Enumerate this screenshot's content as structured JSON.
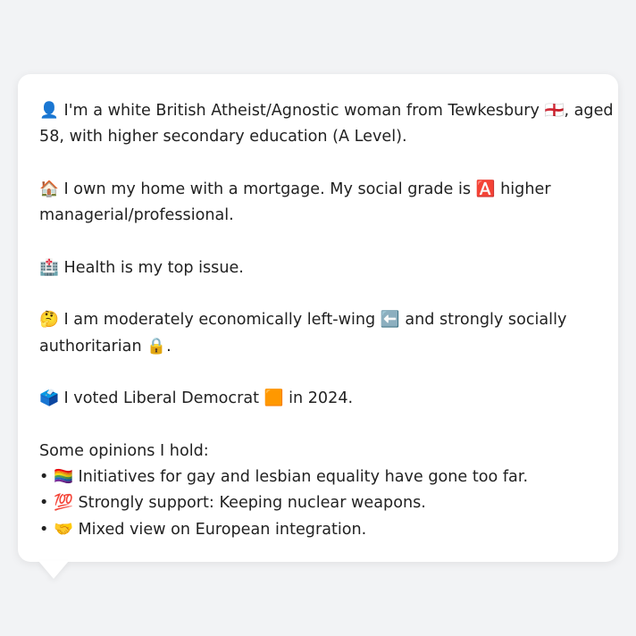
{
  "profile": {
    "identity": {
      "icon": "👤",
      "text1": "I'm a white British Atheist/Agnostic woman from Tewkesbury",
      "flag": "🏴󠁧󠁢󠁥󠁮󠁧󠁿",
      "text2": ", aged",
      "text3": "58, with higher secondary education (A Level)."
    },
    "home": {
      "icon": "🏠",
      "text1": "I own my home with a mortgage. My social grade is",
      "grade_icon": "🅰️",
      "text2": "higher",
      "text3": "managerial/professional."
    },
    "issue": {
      "icon": "🏥",
      "text": "Health is my top issue."
    },
    "politics": {
      "icon": "🤔",
      "text1": "I am moderately economically left-wing",
      "left_icon": "⬅️",
      "text2": "and strongly socially",
      "text3": "authoritarian",
      "lock_icon": "🔒",
      "text4": "."
    },
    "vote": {
      "icon": "🗳️",
      "text1": "I voted Liberal Democrat",
      "party_icon": "🟧",
      "text2": "in 2024."
    },
    "opinions": {
      "heading": "Some opinions I hold:",
      "items": [
        {
          "bullet": "•",
          "icon": "🏳️‍🌈",
          "text": "Initiatives for gay and lesbian equality have gone too far."
        },
        {
          "bullet": "•",
          "icon": "💯",
          "text": "Strongly support: Keeping nuclear weapons."
        },
        {
          "bullet": "•",
          "icon": "🤝",
          "text": "Mixed view on European integration."
        }
      ]
    }
  }
}
